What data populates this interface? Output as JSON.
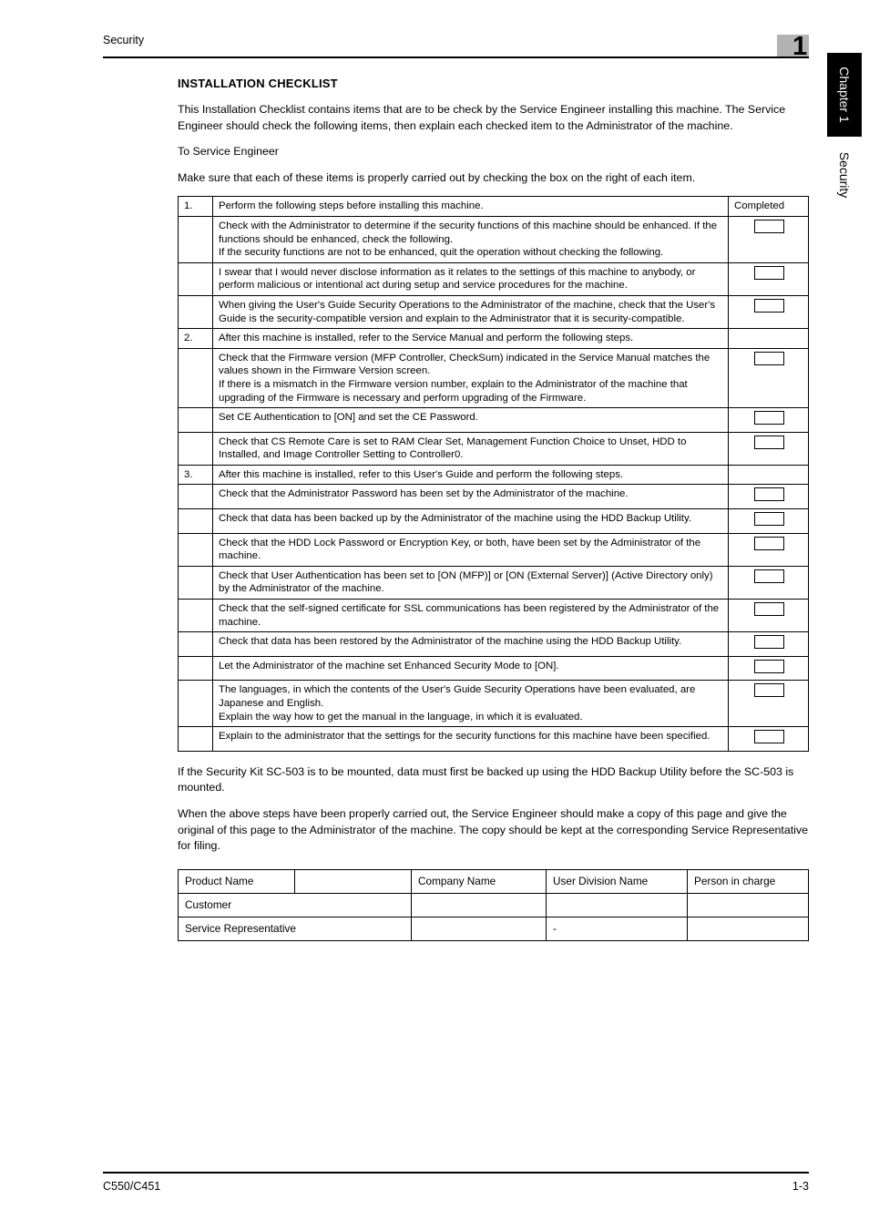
{
  "header": {
    "title": "Security",
    "chapter_number": "1"
  },
  "side_tab": {
    "chapter_label": "Chapter 1",
    "section_label": "Security"
  },
  "main": {
    "section_title": "INSTALLATION CHECKLIST",
    "intro_paragraph": "This Installation Checklist contains items that are to be check by the Service Engineer installing this machine. The Service Engineer should check the following items, then explain each checked item to the Administrator of the machine.",
    "to_service_engineer": "To Service Engineer",
    "instruction": "Make sure that each of these items is properly carried out by checking the box on the right of each item.",
    "closing_paragraph_1": "If the Security Kit SC-503 is to be mounted, data must first be backed up using the HDD Backup Utility before the SC-503 is mounted.",
    "closing_paragraph_2": "When the above steps have been properly carried out, the Service Engineer should make a copy of this page and give the original of this page to the Administrator of the machine. The copy should be kept at the corresponding Service Representative for filing."
  },
  "checklist": {
    "completed_header": "Completed",
    "rows": [
      {
        "num": "1.",
        "text": "Perform the following steps before installing this machine.",
        "checkbox": false,
        "is_step": true
      },
      {
        "num": "",
        "text": "Check with the Administrator to determine if the security functions of this machine should be enhanced. If the functions should be enhanced, check the following.\nIf the security functions are not to be enhanced, quit the operation without checking the following.",
        "checkbox": true,
        "is_step": false
      },
      {
        "num": "",
        "text": "I swear that I would never disclose information as it relates to the settings of this machine to anybody, or perform malicious or intentional act during setup and service procedures for the machine.",
        "checkbox": true,
        "is_step": false
      },
      {
        "num": "",
        "text": "When giving the User's Guide Security Operations to the Administrator of the machine, check that the User's Guide is the security-compatible version and explain to the Administrator that it is security-compatible.",
        "checkbox": true,
        "is_step": false
      },
      {
        "num": "2.",
        "text": "After this machine is installed, refer to the Service Manual and perform the following steps.",
        "checkbox": false,
        "is_step": true
      },
      {
        "num": "",
        "text": "Check that the Firmware version (MFP Controller, CheckSum) indicated in the Service Manual matches the values shown in the Firmware Version screen.\nIf there is a mismatch in the Firmware version number, explain to the Administrator of the machine that upgrading of the Firmware is necessary and perform upgrading of the Firmware.",
        "checkbox": true,
        "is_step": false
      },
      {
        "num": "",
        "text": "Set CE Authentication to [ON] and set the CE Password.",
        "checkbox": true,
        "is_step": false
      },
      {
        "num": "",
        "text": "Check that CS Remote Care is set to RAM Clear Set, Management Function Choice to Unset, HDD to Installed, and Image Controller Setting to Controller0.",
        "checkbox": true,
        "is_step": false
      },
      {
        "num": "3.",
        "text": "After this machine is installed, refer to this User's Guide and perform the following steps.",
        "checkbox": false,
        "is_step": true
      },
      {
        "num": "",
        "text": "Check that the Administrator Password has been set by the Administrator of the machine.",
        "checkbox": true,
        "is_step": false
      },
      {
        "num": "",
        "text": "Check that data has been backed up by the Administrator of the machine using the HDD Backup Utility.",
        "checkbox": true,
        "is_step": false
      },
      {
        "num": "",
        "text": "Check that the HDD Lock Password or Encryption Key, or both, have been set by the Administrator of the machine.",
        "checkbox": true,
        "is_step": false
      },
      {
        "num": "",
        "text": "Check that User Authentication has been set to [ON (MFP)] or [ON (External Server)] (Active Directory only) by the Administrator of the machine.",
        "checkbox": true,
        "is_step": false
      },
      {
        "num": "",
        "text": "Check that the self-signed certificate for SSL communications has been registered by the Administrator of the machine.",
        "checkbox": true,
        "is_step": false
      },
      {
        "num": "",
        "text": "Check that data has been restored by the Administrator of the machine using the HDD Backup Utility.",
        "checkbox": true,
        "is_step": false
      },
      {
        "num": "",
        "text": "Let the Administrator of the machine set Enhanced Security Mode to [ON].",
        "checkbox": true,
        "is_step": false
      },
      {
        "num": "",
        "text": "The languages, in which the contents of the User's Guide Security Operations have been evaluated, are Japanese and English.\nExplain the way how to get the manual in the language, in which it is evaluated.",
        "checkbox": true,
        "is_step": false
      },
      {
        "num": "",
        "text": "Explain to the administrator that the settings for the security functions for this machine have been specified.",
        "checkbox": true,
        "is_step": false
      }
    ]
  },
  "signoff_table": {
    "header": {
      "product_name": "Product Name",
      "product_value": "",
      "company_name": "Company Name",
      "user_division_name": "User Division Name",
      "person_in_charge": "Person in charge"
    },
    "rows": [
      {
        "label": "Customer",
        "company": "",
        "division": "",
        "person": ""
      },
      {
        "label": "Service Representative",
        "company": "",
        "division": "-",
        "person": ""
      }
    ]
  },
  "footer": {
    "left": "C550/C451",
    "right": "1-3"
  }
}
